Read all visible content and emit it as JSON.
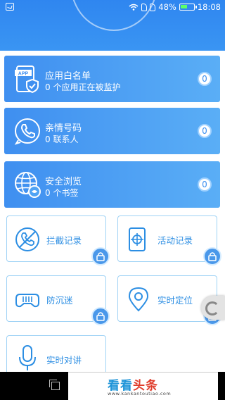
{
  "status_bar": {
    "battery": "48%",
    "time": "18:08"
  },
  "cards": [
    {
      "title": "应用白名单",
      "subtitle": "0 个应用正在被监护",
      "badge": "0",
      "icon": "app-shield-icon",
      "icon_text": "APP"
    },
    {
      "title": "亲情号码",
      "subtitle": "0 联系人",
      "badge": "0",
      "icon": "phone-icon"
    },
    {
      "title": "安全浏览",
      "subtitle": "0 个书签",
      "badge": "0",
      "icon": "globe-icon"
    }
  ],
  "tiles": [
    {
      "label": "拦截记录",
      "icon": "blocked-call-icon",
      "locked": true
    },
    {
      "label": "活动记录",
      "icon": "tablet-target-icon",
      "locked": true
    },
    {
      "label": "防沉迷",
      "icon": "gamepad-icon",
      "locked": true
    },
    {
      "label": "实时定位",
      "icon": "location-pin-icon",
      "locked": true
    },
    {
      "label": "实时对讲",
      "icon": "microphone-icon",
      "locked": false
    }
  ],
  "watermark": {
    "part1": "看看",
    "part2": "头条",
    "url": "www.kankantoutiao.com"
  },
  "colors": {
    "header": "#2f86f0",
    "card_start": "#3f8ff0",
    "card_end": "#5aaef6",
    "tile_border": "#9ed2f5",
    "accent": "#2c8ee3"
  }
}
